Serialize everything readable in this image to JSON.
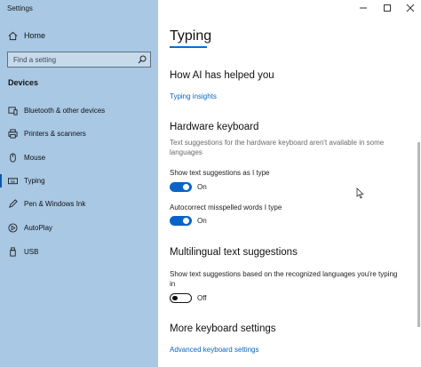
{
  "window": {
    "title": "Settings"
  },
  "sidebar": {
    "home_label": "Home",
    "search_placeholder": "Find a setting",
    "section_title": "Devices",
    "items": [
      {
        "label": "Bluetooth & other devices",
        "icon": "bluetooth-devices-icon"
      },
      {
        "label": "Printers & scanners",
        "icon": "printer-icon"
      },
      {
        "label": "Mouse",
        "icon": "mouse-icon"
      },
      {
        "label": "Typing",
        "icon": "keyboard-icon",
        "active": true
      },
      {
        "label": "Pen & Windows Ink",
        "icon": "pen-icon"
      },
      {
        "label": "AutoPlay",
        "icon": "autoplay-icon"
      },
      {
        "label": "USB",
        "icon": "usb-icon"
      }
    ]
  },
  "main": {
    "page_title": "Typing",
    "ai_section": {
      "heading": "How AI has helped you",
      "link": "Typing insights"
    },
    "hardware_section": {
      "heading": "Hardware keyboard",
      "description": "Text suggestions for the hardware keyboard aren't available in some languages",
      "options": [
        {
          "label": "Show text suggestions as I type",
          "state": "On",
          "on": true
        },
        {
          "label": "Autocorrect misspelled words I type",
          "state": "On",
          "on": true
        }
      ]
    },
    "multilingual_section": {
      "heading": "Multilingual text suggestions",
      "label": "Show text suggestions based on the recognized languages you're typing in",
      "state": "Off",
      "on": false
    },
    "more_section": {
      "heading": "More keyboard settings",
      "link": "Advanced keyboard settings"
    }
  },
  "colors": {
    "sidebar_bg": "#a8c8e4",
    "accent": "#0a64c8",
    "link": "#0a64c0"
  }
}
